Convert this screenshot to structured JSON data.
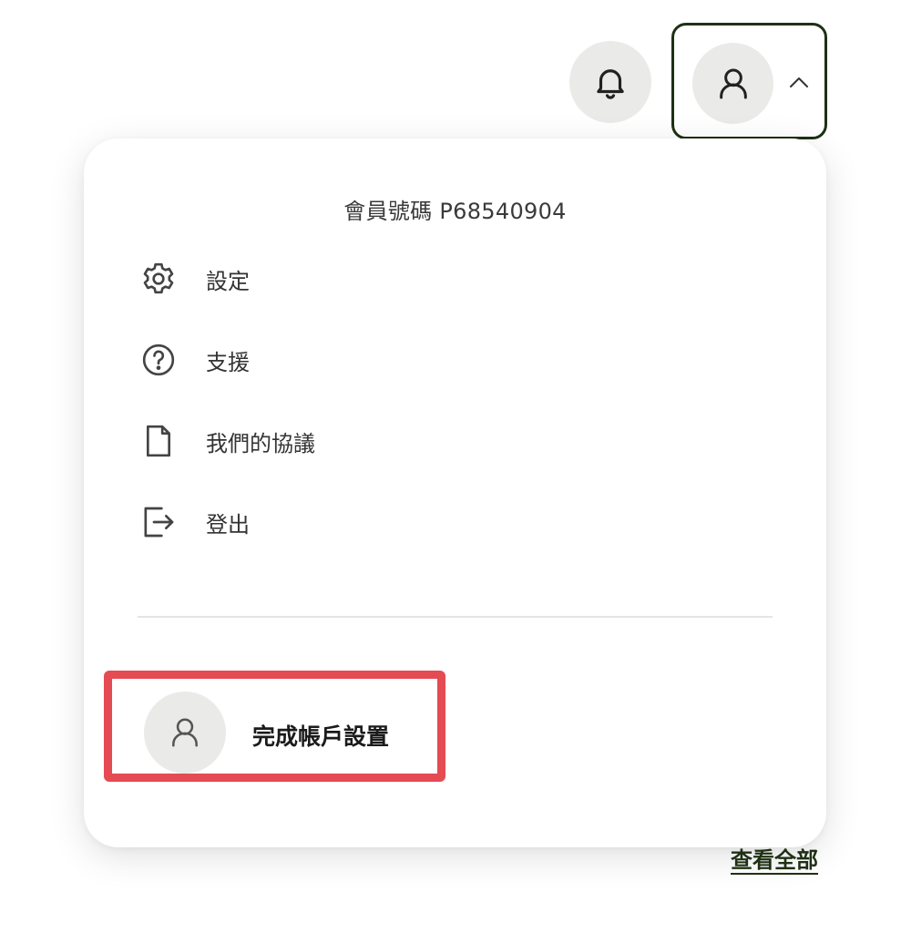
{
  "header": {
    "bell_icon": "bell-icon",
    "account_icon": "user-icon",
    "chevron_icon": "chevron-up-icon"
  },
  "menu": {
    "member_id": "會員號碼 P68540904",
    "items": [
      {
        "label": "設定",
        "icon": "gear-icon"
      },
      {
        "label": "支援",
        "icon": "question-circle-icon"
      },
      {
        "label": "我們的協議",
        "icon": "document-icon"
      },
      {
        "label": "登出",
        "icon": "logout-icon"
      }
    ],
    "complete_setup": {
      "label": "完成帳戶設置",
      "icon": "user-icon"
    }
  },
  "footer": {
    "view_all": "查看全部"
  },
  "colors": {
    "accent_dark_green": "#1f3014",
    "highlight_red": "#e54b53",
    "icon_bg": "#eaebe8"
  }
}
